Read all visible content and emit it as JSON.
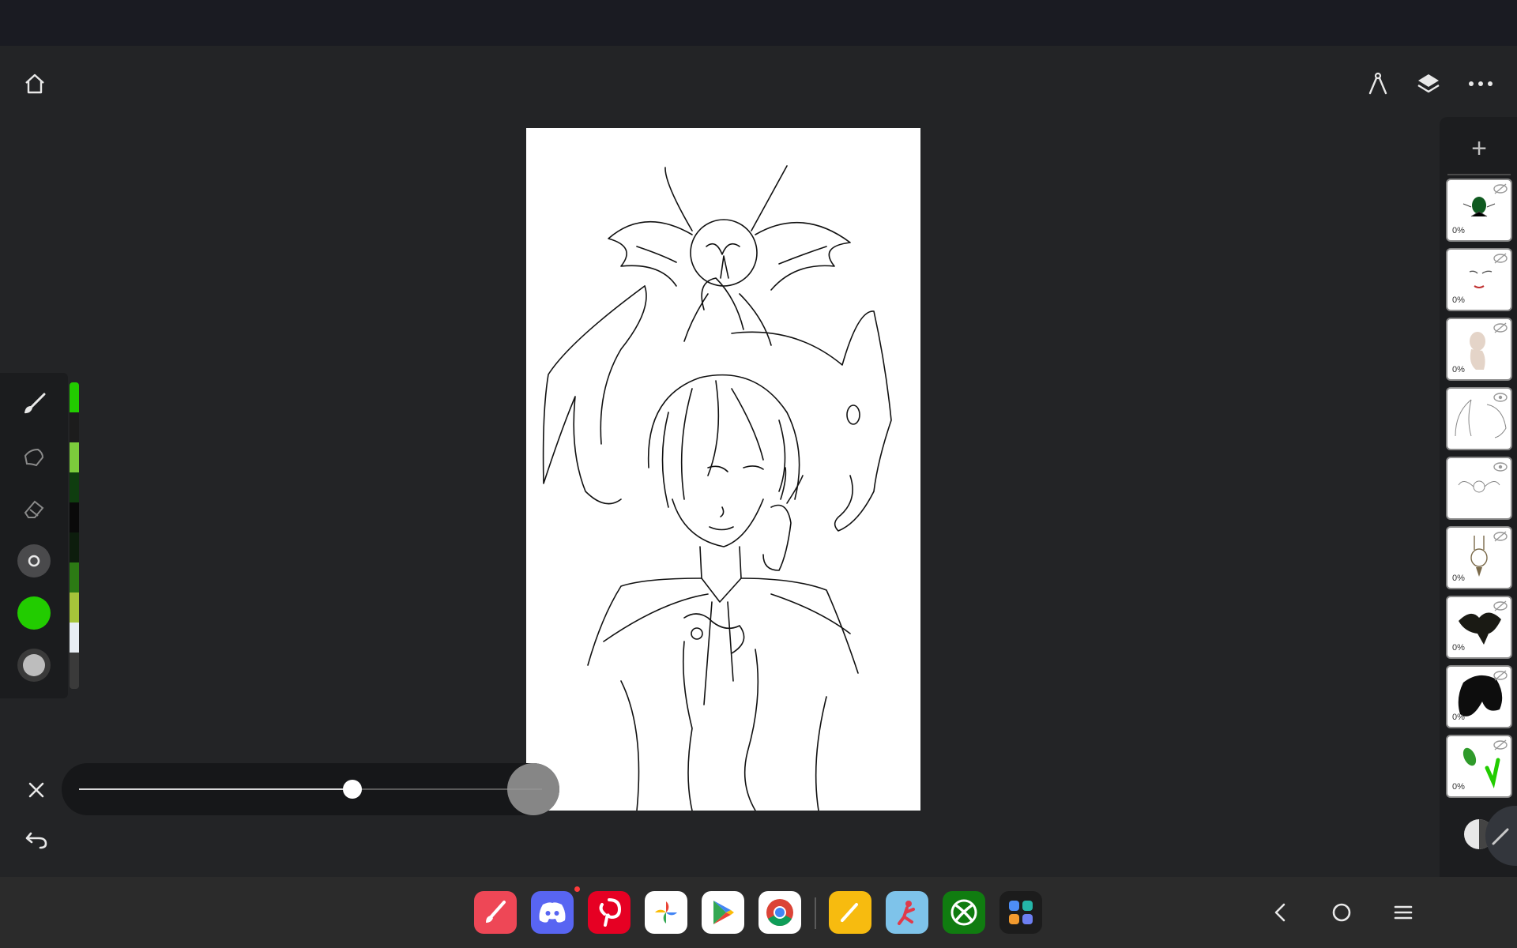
{
  "app": {
    "name": "Drawing canvas"
  },
  "toolbar": {
    "home_icon": "home-icon",
    "ruler_icon": "ruler-compass-icon",
    "layers_icon": "layers-icon",
    "more_icon": "more-icon"
  },
  "tools": [
    {
      "name": "brush-icon",
      "active": true
    },
    {
      "name": "smudge-icon",
      "active": false
    },
    {
      "name": "eraser-icon",
      "active": false
    },
    {
      "name": "brush-size-icon",
      "active": false
    },
    {
      "name": "color-picker",
      "active": false
    },
    {
      "name": "opacity-icon",
      "active": false
    }
  ],
  "current_color": "#22cc00",
  "palette": [
    "#22cc00",
    "#1c1c1c",
    "#7ccc3c",
    "#0f3d0f",
    "#0a0a0a",
    "#0d1d0d",
    "#2c7a14",
    "#a6c43a",
    "#e8eef4",
    "#3a3a3a"
  ],
  "slider": {
    "value": 0.59
  },
  "layers": {
    "add_label": "+",
    "items": [
      {
        "opacity": "0%",
        "visible": false
      },
      {
        "opacity": "0%",
        "visible": false
      },
      {
        "opacity": "0%",
        "visible": false
      },
      {
        "opacity": "",
        "visible": true
      },
      {
        "opacity": "",
        "visible": true
      },
      {
        "opacity": "0%",
        "visible": false
      },
      {
        "opacity": "0%",
        "visible": false
      },
      {
        "opacity": "0%",
        "visible": false
      },
      {
        "opacity": "0%",
        "visible": false
      }
    ]
  },
  "taskbar": {
    "apps": [
      "sketch-app",
      "discord",
      "pinterest",
      "google-photos",
      "play-store",
      "chrome",
      "notes",
      "game-app",
      "xbox",
      "app-drawer"
    ],
    "nav": [
      "back-icon",
      "home-circle-icon",
      "recents-icon"
    ]
  }
}
